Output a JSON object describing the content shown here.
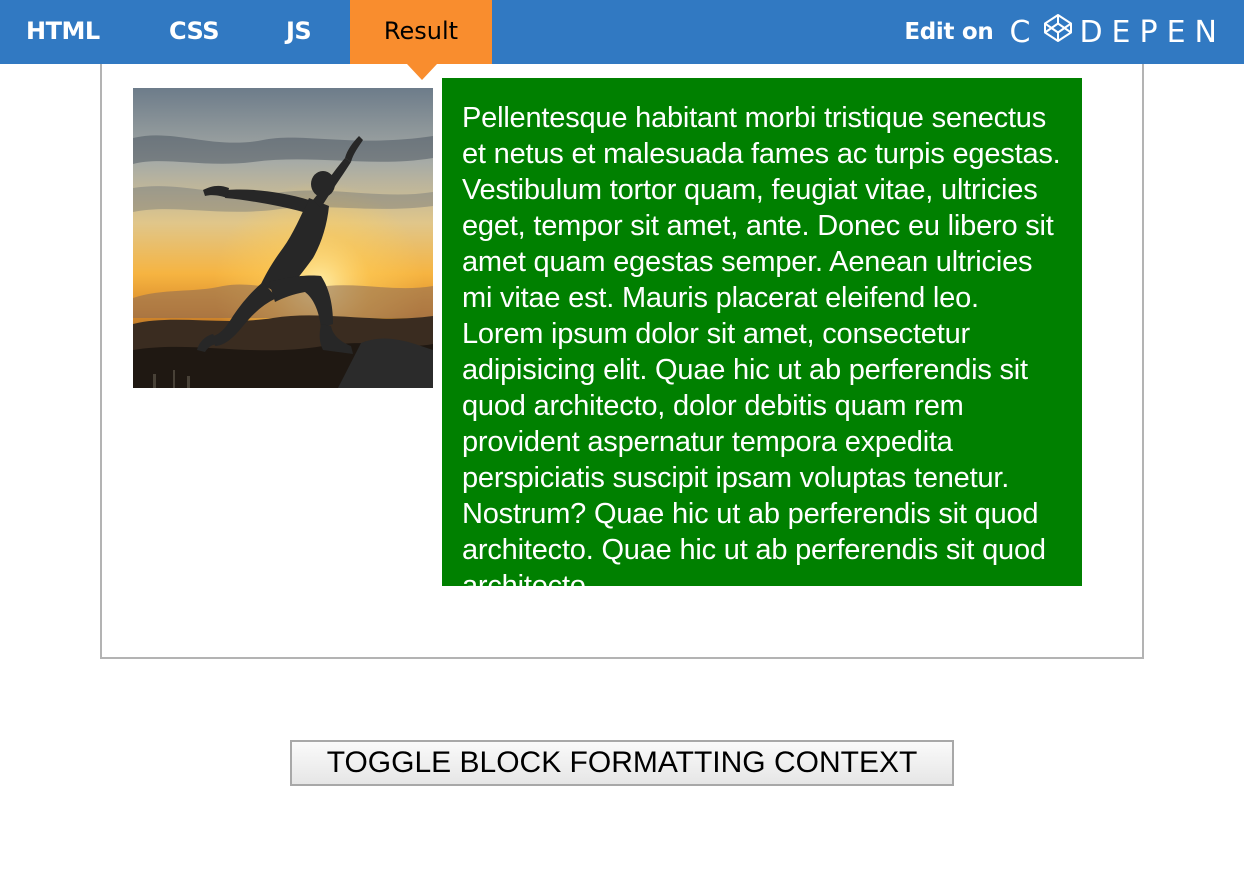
{
  "tabs": {
    "html": "HTML",
    "css": "CSS",
    "js": "JS",
    "result": "Result"
  },
  "edit_on": {
    "label": "Edit on",
    "brand_prefix": "C",
    "brand_suffix": "DEPEN"
  },
  "content": {
    "image_alt": "Silhouette of a person jumping against a sunset sky",
    "paragraph": "Pellentesque habitant morbi tristique senectus et netus et malesuada fames ac turpis egestas. Vestibulum tortor quam, feugiat vitae, ultricies eget, tempor sit amet, ante. Donec eu libero sit amet quam egestas semper. Aenean ultricies mi vitae est. Mauris placerat eleifend leo. Lorem ipsum dolor sit amet, consectetur adipisicing elit. Quae hic ut ab perferendis sit quod architecto, dolor debitis quam rem provident aspernatur tempora expedita perspiciatis suscipit ipsam voluptas tenetur. Nostrum? Quae hic ut ab perferendis sit quod architecto. Quae hic ut ab perferendis sit quod architecto."
  },
  "button": {
    "label": "TOGGLE BLOCK FORMATTING CONTEXT"
  },
  "colors": {
    "topbar": "#3179c2",
    "active_tab": "#f98d2e",
    "content_box": "#008000"
  }
}
